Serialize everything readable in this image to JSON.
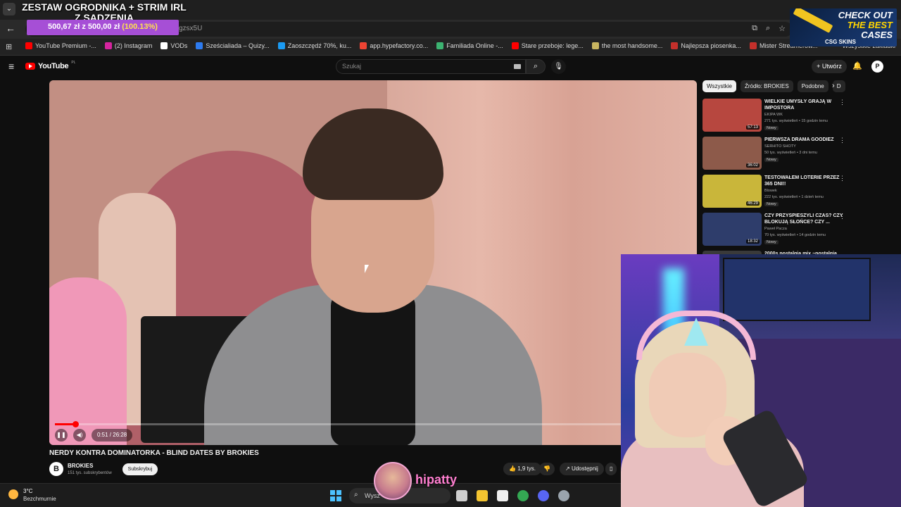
{
  "overlay": {
    "stream_title": "ZESTAW OGRODNIKA + STRIM IRL Z SADZENIA",
    "goal_current": "500,67 zł",
    "goal_sep": "z",
    "goal_target": "500,00 zł",
    "goal_percent": "(100.13%)",
    "goal_progress": 1.0,
    "ad_line1": "CHECK OUT",
    "ad_line2": "THE BEST",
    "ad_line3": "CASES",
    "ad_brand": "CSG SKINS",
    "viewer_name": "hipatty"
  },
  "browser": {
    "url_fragment": "gzsx5U",
    "bookmarks": [
      {
        "label": "YouTube Premium -...",
        "color": "#ff0000"
      },
      {
        "label": "(2) Instagram",
        "color": "#d6249f"
      },
      {
        "label": "VODs",
        "color": "#ffffff"
      },
      {
        "label": "Sześcialiada – Quizy...",
        "color": "#2d7bf0"
      },
      {
        "label": "Zaoszczędź 70%, ku...",
        "color": "#1b9af2"
      },
      {
        "label": "app.hypefactory.co...",
        "color": "#e43"
      },
      {
        "label": "Familiada Online -...",
        "color": "#3cb371"
      },
      {
        "label": "Stare przeboje: lege...",
        "color": "#ff0000"
      },
      {
        "label": "the most handsome...",
        "color": "#c8b560"
      },
      {
        "label": "Najlepsza piosenka...",
        "color": "#c4302b"
      },
      {
        "label": "Mister Streamerów...",
        "color": "#c4302b"
      }
    ],
    "bookmarks_all": "Wszystkie zakładki"
  },
  "youtube": {
    "logo": "YouTube",
    "logo_country": "PL",
    "search_placeholder": "Szukaj",
    "create_label": "Utwórz",
    "avatar_letter": "P"
  },
  "video": {
    "time": "0:51 / 26:28",
    "progress": 0.032,
    "title": "NERDY KONTRA DOMINATORKA - BLIND DATES BY BROKIES",
    "channel": "BROKIES",
    "channel_avatar": "B",
    "subscribers": "151 tys. subskrybentów",
    "subscribe_label": "Subskrybuj",
    "likes": "1,9 tys.",
    "share_label": "Udostępnij"
  },
  "sidebar": {
    "chips": [
      "Wszystkie",
      "Źródło: BROKIES",
      "Podobne",
      "D"
    ],
    "recommendations": [
      {
        "title": "WIELKIE UMYSŁY GRAJĄ W IMPOSTORA",
        "channel": "EKIPA WK",
        "meta": "271 tys. wyświetleń • 15 godzin temu",
        "badge": "Nowy",
        "duration": "57:13",
        "color": "#b7473f"
      },
      {
        "title": "PIERWSZA DRAMA GOODIEZ",
        "channel": "SERHITO SHOTY",
        "meta": "50 tys. wyświetleń • 3 dni temu",
        "badge": "Nowy",
        "duration": "36:02",
        "color": "#8d5a4a"
      },
      {
        "title": "TESTOWAŁEM LOTERIE PRZEZ 365 DNI!!",
        "channel": "Blowek",
        "meta": "222 tys. wyświetleń • 1 dzień temu",
        "badge": "Nowy",
        "duration": "46:29",
        "color": "#c9b63a"
      },
      {
        "title": "CZY PRZYSPIESZYLI CZAS? CZY BLOKUJĄ SŁOŃCE? CZY ...",
        "channel": "Paweł Pacza",
        "meta": "70 tys. wyświetleń • 14 godzin temu",
        "badge": "Nowy",
        "duration": "18:32",
        "color": "#2e3d6b"
      },
      {
        "title": "2000s nostalgia mix ~nostalgia",
        "channel": "",
        "meta": "",
        "badge": "",
        "duration": "",
        "color": "#3a3a3a"
      }
    ]
  },
  "taskbar": {
    "temp": "3°C",
    "weather": "Bezchmurnie",
    "search_text": "Wysz",
    "apps": [
      {
        "name": "task-view",
        "color": "#cfcfcf"
      },
      {
        "name": "file-explorer",
        "color": "#f4c430"
      },
      {
        "name": "store",
        "color": "#f0f0f0"
      },
      {
        "name": "chrome",
        "color": "#34a853"
      },
      {
        "name": "discord",
        "color": "#5865f2"
      },
      {
        "name": "steam",
        "color": "#9aa4ad"
      }
    ]
  }
}
